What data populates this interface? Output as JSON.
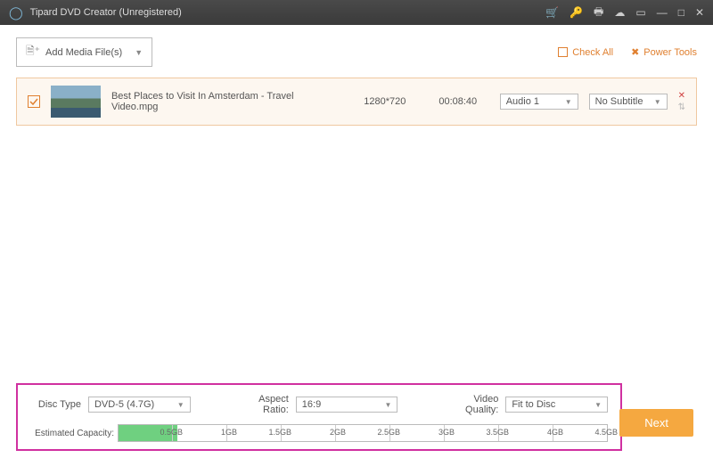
{
  "titlebar": {
    "title": "Tipard DVD Creator (Unregistered)"
  },
  "toolbar": {
    "add_label": "Add Media File(s)",
    "check_all_label": "Check All",
    "power_tools_label": "Power Tools"
  },
  "file": {
    "name": "Best Places to Visit In Amsterdam - Travel Video.mpg",
    "resolution": "1280*720",
    "duration": "00:08:40",
    "audio_selected": "Audio 1",
    "subtitle_selected": "No Subtitle"
  },
  "settings": {
    "disc_type_label": "Disc Type",
    "disc_type_value": "DVD-5 (4.7G)",
    "aspect_label": "Aspect Ratio:",
    "aspect_value": "16:9",
    "quality_label": "Video Quality:",
    "quality_value": "Fit to Disc",
    "capacity_label": "Estimated Capacity:",
    "ticks": [
      "0.5GB",
      "1GB",
      "1.5GB",
      "2GB",
      "2.5GB",
      "3GB",
      "3.5GB",
      "4GB",
      "4.5GB"
    ]
  },
  "next_label": "Next"
}
